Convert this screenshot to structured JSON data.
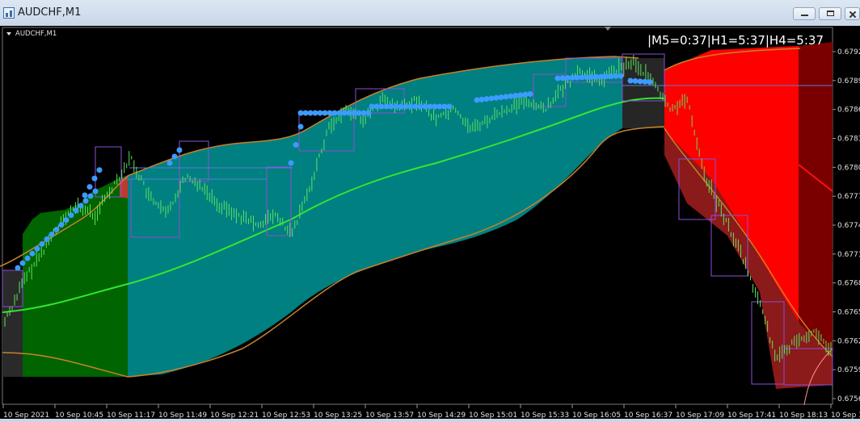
{
  "window": {
    "title": "AUDCHF,M1",
    "controls": [
      "minimize",
      "restore",
      "close"
    ]
  },
  "chart": {
    "symbol_label": "AUDCHF,M1",
    "timer_label": "|M5=0:37|H1=5:37|H4=5:37",
    "background": "#000000",
    "colors": {
      "band_fill": "#008080",
      "band_border": "#c8822a",
      "bull_zone": "#006400",
      "bear_zone": "#ff0000",
      "dark_bear_zone": "#7a0000",
      "mid_line": "#32e632",
      "price_bars": "#5fe15f",
      "dots": "#3c9bff",
      "boxes": "#8a4fd8",
      "hline": "#5b7bd8"
    }
  },
  "chart_data": {
    "type": "line",
    "title": "",
    "price_scale": [
      "0.67920",
      "0.67890",
      "0.67860",
      "0.67830",
      "0.67800",
      "0.67770",
      "0.67740",
      "0.67710",
      "0.67680",
      "0.67650",
      "0.67620",
      "0.67590",
      "0.67560"
    ],
    "time_labels": [
      "10 Sep 2021",
      "10 Sep 10:45",
      "10 Sep 11:17",
      "10 Sep 11:49",
      "10 Sep 12:21",
      "10 Sep 12:53",
      "10 Sep 13:25",
      "10 Sep 13:57",
      "10 Sep 14:29",
      "10 Sep 15:01",
      "10 Sep 15:33",
      "10 Sep 16:05",
      "10 Sep 16:37",
      "10 Sep 17:09",
      "10 Sep 17:41",
      "10 Sep 18:13",
      "10 Sep 1"
    ],
    "current_price": 0.6789,
    "series": [
      {
        "values": [
          0.6764,
          0.6768,
          0.6771,
          0.6774,
          0.6776,
          0.6775,
          0.6778,
          0.6781,
          0.6777,
          0.6775,
          0.6779,
          0.6778,
          0.6776,
          0.6775,
          0.6774,
          0.6775,
          0.6773,
          0.6778,
          0.6784,
          0.6786,
          0.6785,
          0.6787,
          0.6786,
          0.6787,
          0.6785,
          0.6786,
          0.6784,
          0.6785,
          0.6786,
          0.6787,
          0.6786,
          0.6788,
          0.679,
          0.6789,
          0.679,
          0.6791,
          0.6789,
          0.6786,
          0.6787,
          0.6779,
          0.6775,
          0.6771,
          0.6766,
          0.676,
          0.6762,
          0.6763,
          0.6761
        ]
      }
    ]
  }
}
